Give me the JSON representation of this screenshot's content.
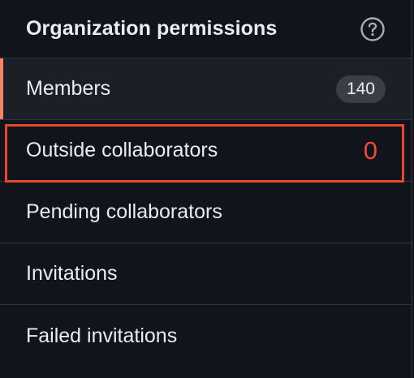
{
  "header": {
    "title": "Organization permissions",
    "help_icon": "question-circle-icon"
  },
  "items": [
    {
      "label": "Members",
      "count": "140",
      "selected": true
    },
    {
      "label": "Outside collaborators",
      "count": "0",
      "highlighted": true
    },
    {
      "label": "Pending collaborators"
    },
    {
      "label": "Invitations"
    },
    {
      "label": "Failed invitations"
    }
  ],
  "colors": {
    "selected_accent": "#f78166",
    "highlight": "#e5472f",
    "badge_bg": "#3a3f47"
  }
}
